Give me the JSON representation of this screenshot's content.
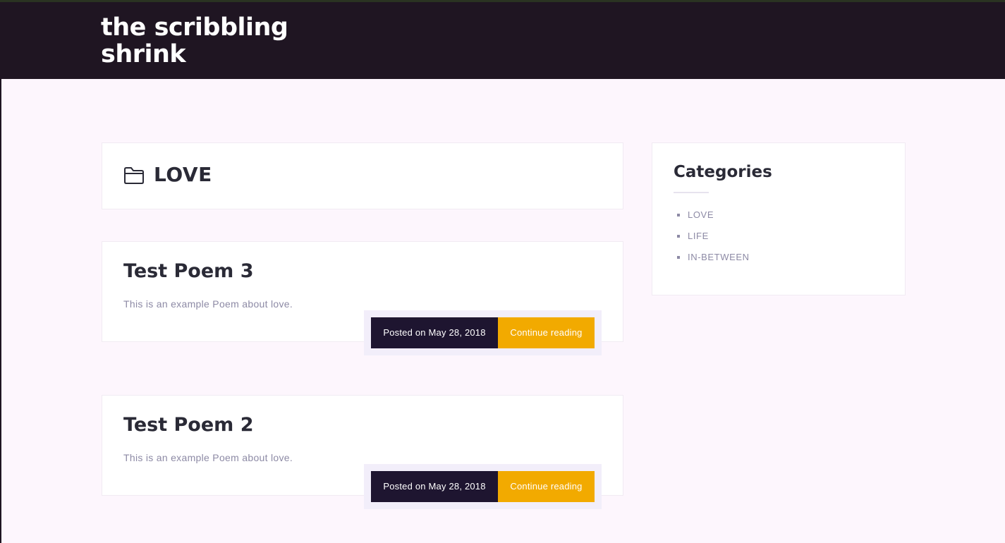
{
  "site": {
    "title": "the scribbling shrink"
  },
  "archive": {
    "title": "LOVE",
    "icon": "folder-icon"
  },
  "posts": [
    {
      "title": "Test Poem 3",
      "excerpt": "This is an example Poem about love.",
      "posted": "Posted on May 28, 2018",
      "continue_label": "Continue reading"
    },
    {
      "title": "Test Poem 2",
      "excerpt": "This is an example Poem about love.",
      "posted": "Posted on May 28, 2018",
      "continue_label": "Continue reading"
    }
  ],
  "sidebar": {
    "title": "Categories",
    "categories": [
      "LOVE",
      "LIFE",
      "IN-BETWEEN"
    ]
  },
  "colors": {
    "header_bg": "#1f1522",
    "page_bg": "#fdf6fd",
    "meta_dark": "#1e1530",
    "accent": "#f2aa00",
    "muted_text": "#8d8aa5",
    "heading_text": "#2a2a36"
  }
}
